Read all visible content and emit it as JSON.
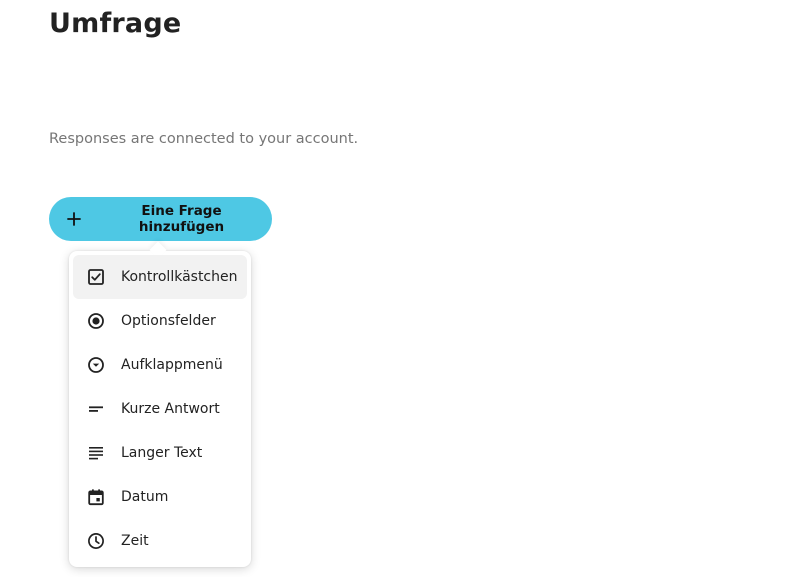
{
  "page": {
    "title": "Umfrage",
    "subtitle": "Responses are connected to your account."
  },
  "add_button": {
    "label": "Eine Frage hinzufügen",
    "icon": "plus-icon",
    "color": "#4ec8e4"
  },
  "menu": {
    "items": [
      {
        "label": "Kontrollkästchen",
        "icon": "checkbox-icon",
        "active": true
      },
      {
        "label": "Optionsfelder",
        "icon": "radio-button-icon",
        "active": false
      },
      {
        "label": "Aufklappmenü",
        "icon": "dropdown-icon",
        "active": false
      },
      {
        "label": "Kurze Antwort",
        "icon": "short-text-icon",
        "active": false
      },
      {
        "label": "Langer Text",
        "icon": "long-text-icon",
        "active": false
      },
      {
        "label": "Datum",
        "icon": "calendar-icon",
        "active": false
      },
      {
        "label": "Zeit",
        "icon": "clock-icon",
        "active": false
      }
    ]
  }
}
